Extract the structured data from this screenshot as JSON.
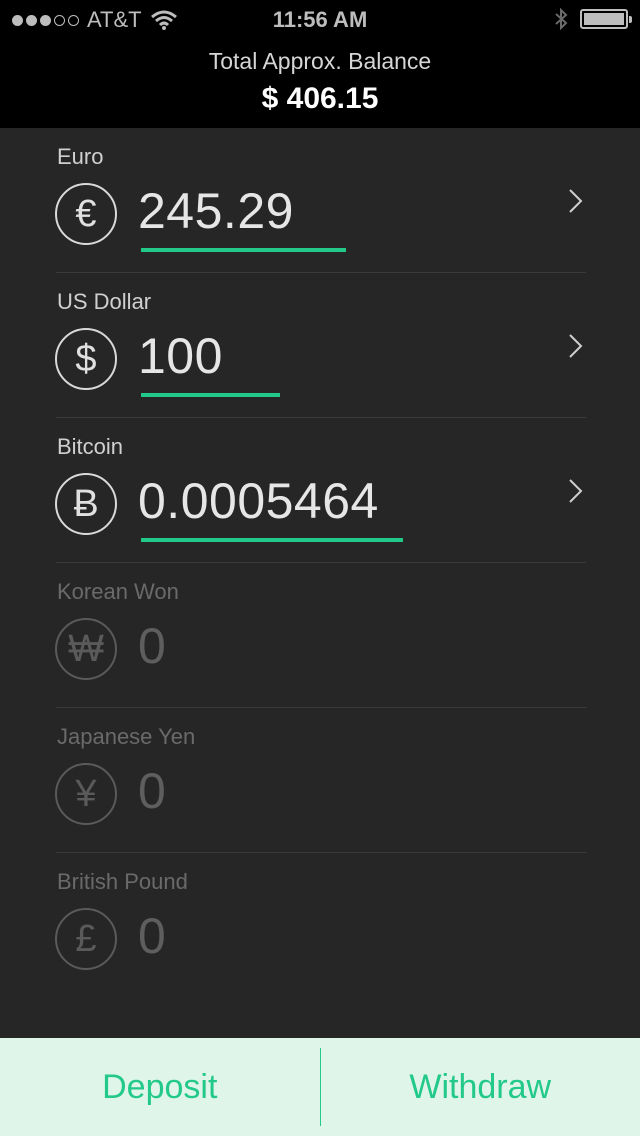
{
  "status_bar": {
    "carrier": "AT&T",
    "time": "11:56 AM",
    "signal_bars": 3
  },
  "header": {
    "balance_label": "Total Approx. Balance",
    "balance_value": "$ 406.15"
  },
  "currencies": [
    {
      "name": "Euro",
      "symbol": "€",
      "amount": "245.29",
      "active": true
    },
    {
      "name": "US Dollar",
      "symbol": "$",
      "amount": "100",
      "active": true
    },
    {
      "name": "Bitcoin",
      "symbol": "Ƀ",
      "amount": "0.0005464",
      "active": true
    },
    {
      "name": "Korean Won",
      "symbol": "₩",
      "amount": "0",
      "active": false
    },
    {
      "name": "Japanese Yen",
      "symbol": "¥",
      "amount": "0",
      "active": false
    },
    {
      "name": "British Pound",
      "symbol": "£",
      "amount": "0",
      "active": false
    }
  ],
  "actions": {
    "deposit": "Deposit",
    "withdraw": "Withdraw"
  },
  "colors": {
    "accent": "#22c989",
    "background": "#262626",
    "action_bar": "#dff5ea"
  }
}
